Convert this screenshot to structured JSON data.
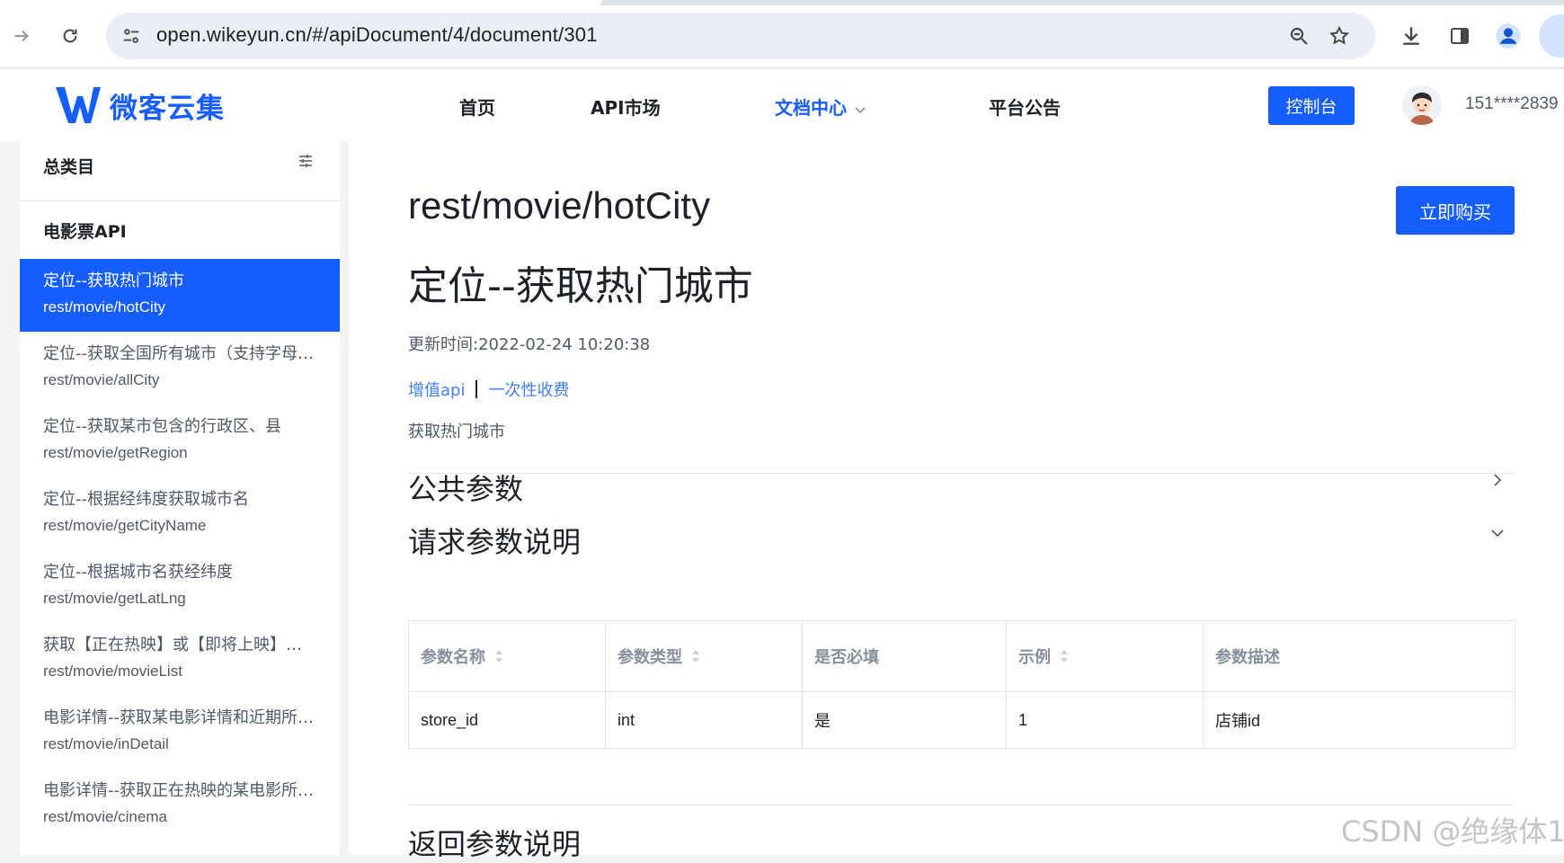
{
  "browser": {
    "url": "open.wikeyun.cn/#/apiDocument/4/document/301"
  },
  "site": {
    "logo_text": "微客云集",
    "nav": [
      {
        "label": "首页"
      },
      {
        "label": "API市场"
      },
      {
        "label": "文档中心"
      },
      {
        "label": "平台公告"
      }
    ],
    "console_label": "控制台",
    "username": "151****2839"
  },
  "sidebar": {
    "title": "总类目",
    "category": "电影票API",
    "items": [
      {
        "name": "定位--获取热门城市",
        "path": "rest/movie/hotCity"
      },
      {
        "name": "定位--获取全国所有城市（支持字母…",
        "path": "rest/movie/allCity"
      },
      {
        "name": "定位--获取某市包含的行政区、县",
        "path": "rest/movie/getRegion"
      },
      {
        "name": "定位--根据经纬度获取城市名",
        "path": "rest/movie/getCityName"
      },
      {
        "name": "定位--根据城市名获经纬度",
        "path": "rest/movie/getLatLng"
      },
      {
        "name": "获取【正在热映】或【即将上映】电…",
        "path": "rest/movie/movieList"
      },
      {
        "name": "电影详情--获取某电影详情和近期所…",
        "path": "rest/movie/inDetail"
      },
      {
        "name": "电影详情--获取正在热映的某电影所…",
        "path": "rest/movie/cinema"
      }
    ]
  },
  "doc": {
    "api_path": "rest/movie/hotCity",
    "buy_label": "立即购买",
    "api_name": "定位--获取热门城市",
    "update_time": "更新时间:2022-02-24 10:20:38",
    "tag_1": "增值api",
    "tag_2": "一次性收费",
    "description": "获取热门城市",
    "public_params_title": "公共参数",
    "request_params_title": "请求参数说明",
    "response_params_title": "返回参数说明",
    "table": {
      "headers": [
        "参数名称",
        "参数类型",
        "是否必填",
        "示例",
        "参数描述"
      ],
      "rows": [
        [
          "store_id",
          "int",
          "是",
          "1",
          "店铺id"
        ]
      ]
    }
  },
  "watermark": "CSDN @绝缘体1",
  "colors": {
    "accent": "#165dff",
    "link": "#4080ff"
  }
}
